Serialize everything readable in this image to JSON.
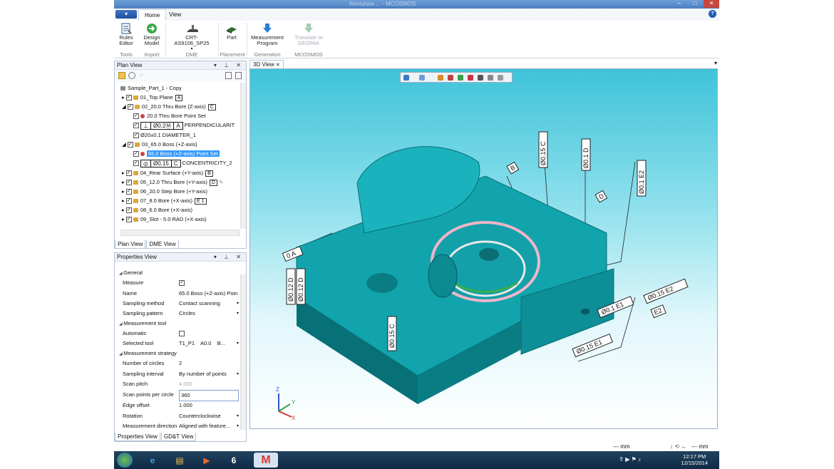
{
  "window": {
    "title": "Renishaw ... - MCOSMOS"
  },
  "ribbon": {
    "tabs": [
      "Home",
      "View"
    ],
    "buttons": {
      "rules_editor": "Rules\nEditor",
      "design_model": "Design\nModel",
      "dme": "CRT-AS9106_SP25",
      "part": "Part",
      "measurement_program": "Measurement\nProgram",
      "translate": "Translate to\nGEOPAK"
    },
    "groups": [
      "Tools",
      "Import",
      "DME",
      "Placement",
      "Generation",
      "MCOSMOS"
    ]
  },
  "plan_view": {
    "title": "Plan View",
    "root": "Sample_Part_1 - Copy",
    "items": [
      {
        "label": "01_Top Plane",
        "badge": "A"
      },
      {
        "label": "02_20.0 Thru Bore (Z-axis)",
        "badge": "C"
      },
      {
        "label": "20.0 Thru Bore Point Set"
      },
      {
        "fcf": [
          "⊥",
          "Ø0.2Ⓜ",
          "A"
        ],
        "label": "PERPENDICULARIT"
      },
      {
        "label": "Ø20±0.1 DIAMETER_1"
      },
      {
        "label": "03_65.0 Boss (+Z-axis)"
      },
      {
        "label": "65.0 Boss (+Z-axis) Point Set"
      },
      {
        "fcf": [
          "◎",
          "Ø0.15",
          "C"
        ],
        "label": "CONCENTRICITY_2"
      },
      {
        "label": "04_Rear Surface (+Y-axis)",
        "badge": "B"
      },
      {
        "label": "05_12.0 Thru Bore (+Y-axis)",
        "badge": "D"
      },
      {
        "label": "06_20.0 Step Bore (+Y-axis)"
      },
      {
        "label": "07_8.0 Bore (+X-axis)",
        "badge": "E 1"
      },
      {
        "label": "08_6.0 Bore (+X-axis)"
      },
      {
        "label": "09_Slot - 5.0 RAD (+X-axis)"
      }
    ],
    "tabs": [
      "Plan View",
      "DME View"
    ]
  },
  "properties_view": {
    "title": "Properties View",
    "rows": [
      {
        "key": "General",
        "cat": true
      },
      {
        "key": "Measure",
        "value": "✓"
      },
      {
        "key": "Name",
        "value": "65.0 Boss (+Z-axis) Poin"
      },
      {
        "key": "Sampling method",
        "value": "Contact scanning"
      },
      {
        "key": "Sampling pattern",
        "value": "Circles"
      },
      {
        "key": "Measurement tool",
        "cat": true
      },
      {
        "key": "Automatic",
        "value": ""
      },
      {
        "key": "Selected tool",
        "value": "T1_P1    A0.0    B..."
      },
      {
        "key": "Measurement strategy",
        "cat": true
      },
      {
        "key": "Number of circles",
        "value": "2"
      },
      {
        "key": "Sampling interval",
        "value": "By number of points"
      },
      {
        "key": "Scan pitch",
        "value": "4.000"
      },
      {
        "key": "Scan points per circle",
        "value": "360"
      },
      {
        "key": "Edge offset",
        "value": "1.000"
      },
      {
        "key": "Rotation",
        "value": "Counterclockwise"
      },
      {
        "key": "Measurement direction",
        "value": "Aligned with feature..."
      }
    ],
    "tabs": [
      "Properties View",
      "GD&T View"
    ]
  },
  "view3d": {
    "tab": "3D View",
    "annotations": [
      "Ø0.15 C",
      "Ø0.1 D",
      "Ø0.1 E2",
      "B",
      "D",
      "Ø0.15 E2",
      "Ø0.1 E1",
      "E2",
      "Ø0.15 E1",
      "Ø0.12 D",
      "Ø0.12 D",
      "0 A",
      "Ø0.15 C"
    ],
    "axes": [
      "Z",
      "Y",
      "X"
    ]
  },
  "statusbar": {
    "units1": "--- mm",
    "units2": "--- mm"
  },
  "taskbar": {
    "time": "12:17 PM",
    "date": "12/15/2014"
  }
}
